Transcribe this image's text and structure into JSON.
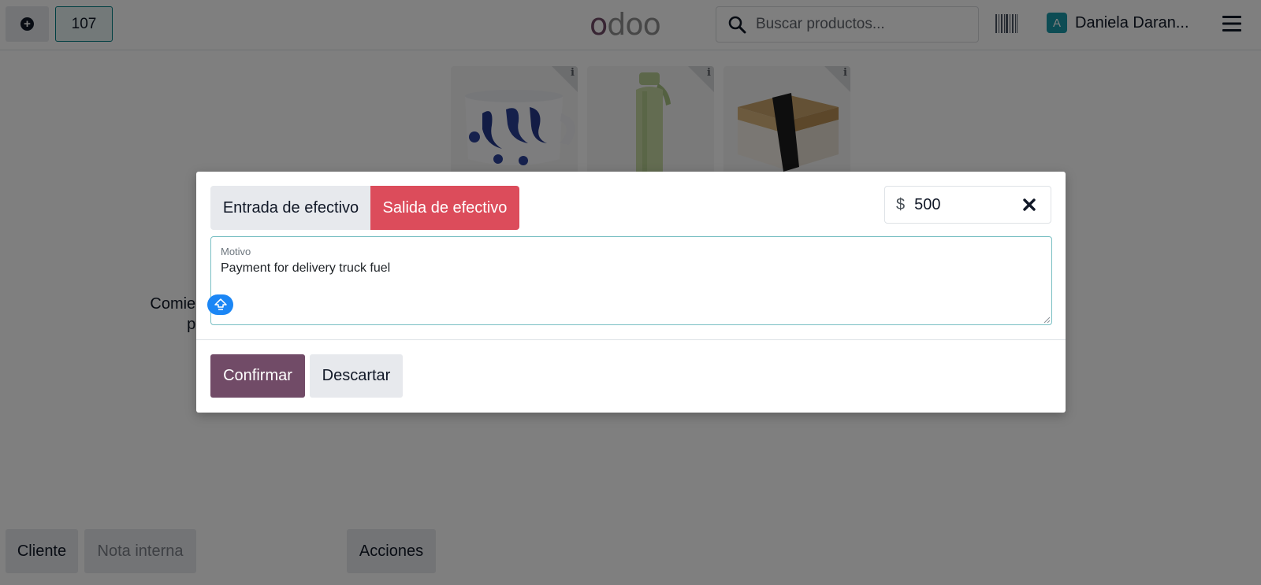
{
  "navbar": {
    "new_order_icon": "plus-circle-icon",
    "order_number": "107",
    "logo_text": "odoo",
    "search": {
      "placeholder": "Buscar productos...",
      "value": ""
    },
    "barcode_icon": "barcode-icon",
    "user": {
      "avatar_letter": "A",
      "name": "Daniela Daran..."
    },
    "menu_icon": "hamburger-menu-icon"
  },
  "order_pane": {
    "empty_message": "Comienza a agregar productos"
  },
  "bottom_actions": {
    "client": "Cliente",
    "internal_note": "Nota interna",
    "actions": "Acciones"
  },
  "products": [
    {
      "name": "mug",
      "info_icon": "info-icon"
    },
    {
      "name": "water-bottle",
      "info_icon": "info-icon"
    },
    {
      "name": "lunch-box",
      "info_icon": "info-icon"
    }
  ],
  "dialog": {
    "cash_in_label": "Entrada de efectivo",
    "cash_out_label": "Salida de efectivo",
    "selected_type": "Salida de efectivo",
    "currency_symbol": "$",
    "amount": "500",
    "reason_label": "Motivo",
    "reason_value": "Payment for delivery truck fuel",
    "confirm_label": "Confirmar",
    "discard_label": "Descartar"
  },
  "colors": {
    "brand": "#714b67",
    "cash_out_active": "#dc4c5b",
    "focus_border": "#78bfc3",
    "accent_teal": "#017e84"
  }
}
